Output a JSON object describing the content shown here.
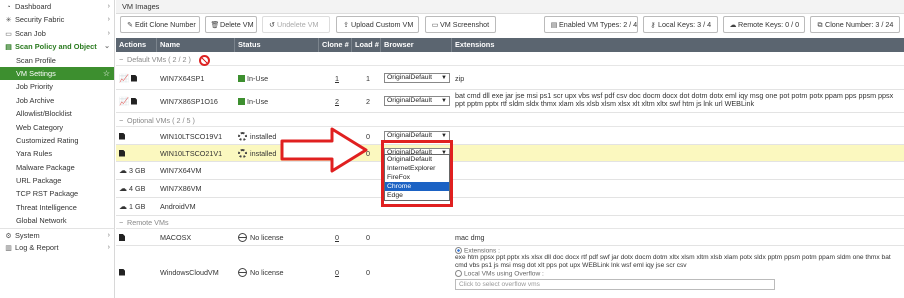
{
  "sidebar": {
    "items": [
      {
        "label": "Dashboard",
        "icon": "dashboard-icon",
        "glyph": "◔",
        "arrow": "›"
      },
      {
        "label": "Security Fabric",
        "icon": "fabric-icon",
        "glyph": "✳",
        "arrow": "›"
      },
      {
        "label": "Scan Job",
        "icon": "scan-job-icon",
        "glyph": "▭",
        "arrow": "›"
      },
      {
        "label": "Scan Policy and Object",
        "icon": "policy-icon",
        "glyph": "▤",
        "arrow": "⌄"
      },
      {
        "label": "Scan Profile"
      },
      {
        "label": "VM Settings",
        "star": "☆"
      },
      {
        "label": "Job Priority"
      },
      {
        "label": "Job Archive"
      },
      {
        "label": "Allowlist/Blocklist"
      },
      {
        "label": "Web Category"
      },
      {
        "label": "Customized Rating"
      },
      {
        "label": "Yara Rules"
      },
      {
        "label": "Malware Package"
      },
      {
        "label": "URL Package"
      },
      {
        "label": "TCP RST Package"
      },
      {
        "label": "Threat Intelligence"
      },
      {
        "label": "Global Network"
      },
      {
        "label": "System",
        "icon": "gear-icon",
        "glyph": "⚙",
        "arrow": "›"
      },
      {
        "label": "Log & Report",
        "icon": "chart-icon",
        "glyph": "▥",
        "arrow": "›"
      }
    ]
  },
  "title": "VM Images",
  "toolbar": {
    "edit_clone": "Edit Clone Number",
    "delete_vm": "Delete VM",
    "undelete_vm": "Undelete VM",
    "upload_vm": "Upload Custom VM",
    "screenshot": "VM Screenshot",
    "enabled_types": "Enabled VM Types:  2 / 4",
    "local_keys": "Local Keys:  3 / 4",
    "remote_keys": "Remote Keys:  0 / 0",
    "clone_number": "Clone Number:  3 / 24"
  },
  "columns": [
    "Actions",
    "Name",
    "Status",
    "Clone #",
    "Load #",
    "Browser",
    "Extensions"
  ],
  "groups": {
    "default": "Default VMs  ( 2 / 2 )",
    "optional": "Optional VMs  ( 2 / 5 )",
    "remote": "Remote VMs"
  },
  "rows": [
    {
      "size": "",
      "name": "WIN7X64SP1",
      "status": "In-Use",
      "clone": "1",
      "load": "1",
      "browser": "OriginalDefault",
      "ext": "zip"
    },
    {
      "size": "",
      "name": "WIN7X86SP1O16",
      "status": "In-Use",
      "clone": "2",
      "load": "2",
      "browser": "OriginalDefault",
      "ext": "bat cmd dll exe jar jse msi ps1 scr upx vbs wsf pdf csv doc docm docx dot dotm dotx eml iqy msg one pot potm potx ppam pps ppsm ppsx ppt pptm pptx rtf sldm sldx thmx xlam xls xlsb xlsm xlsx xlt xltm xltx swf htm js lnk url WEBLink"
    },
    {
      "size": "",
      "name": "WIN10LTSCO19V1",
      "status": "installed",
      "clone": "0",
      "load": "0",
      "browser": "OriginalDefault",
      "ext": ""
    },
    {
      "size": "",
      "name": "WIN10LTSCO21V1",
      "status": "installed",
      "clone": "0",
      "load": "0",
      "browser": "OriginalDefault",
      "ext": ""
    },
    {
      "size": "3 GB",
      "name": "WIN7X64VM",
      "status": "",
      "clone": "",
      "load": "",
      "browser": "",
      "ext": ""
    },
    {
      "size": "4 GB",
      "name": "WIN7X86VM",
      "status": "",
      "clone": "",
      "load": "",
      "browser": "",
      "ext": ""
    },
    {
      "size": "1 GB",
      "name": "AndroidVM",
      "status": "",
      "clone": "",
      "load": "",
      "browser": "",
      "ext": ""
    },
    {
      "size": "",
      "name": "MACOSX",
      "status": "No license",
      "clone": "0",
      "load": "0",
      "browser": "",
      "ext": "mac dmg"
    },
    {
      "size": "",
      "name": "WindowsCloudVM",
      "status": "No license",
      "clone": "0",
      "load": "0",
      "browser": "",
      "ext": "exe htm ppsx ppt pptx xls xlsx dll doc docx rtf pdf swf jar dotx docm dotm xltx xlsm xltm xlsb xlam potx sldx pptm ppsm potm ppam sldm one thmx bat cmd vbs ps1 js msi msg dot xlt pps pot upx WEBLink lnk wsf eml iqy jse scr csv"
    }
  ],
  "overflow": {
    "extensions_label": "Extensions :",
    "local_label": "Local VMs using Overflow :",
    "placeholder": "Click to select overflow vms"
  },
  "dropdown": {
    "options": [
      "OriginalDefault",
      "InternetExplorer",
      "FireFox",
      "Chrome",
      "Edge"
    ],
    "selected": "Chrome"
  },
  "colors": {
    "accent": "#3d8f2f",
    "header": "#5b6570",
    "highlight": "#fbf8bf",
    "annotation": "#e02020"
  }
}
